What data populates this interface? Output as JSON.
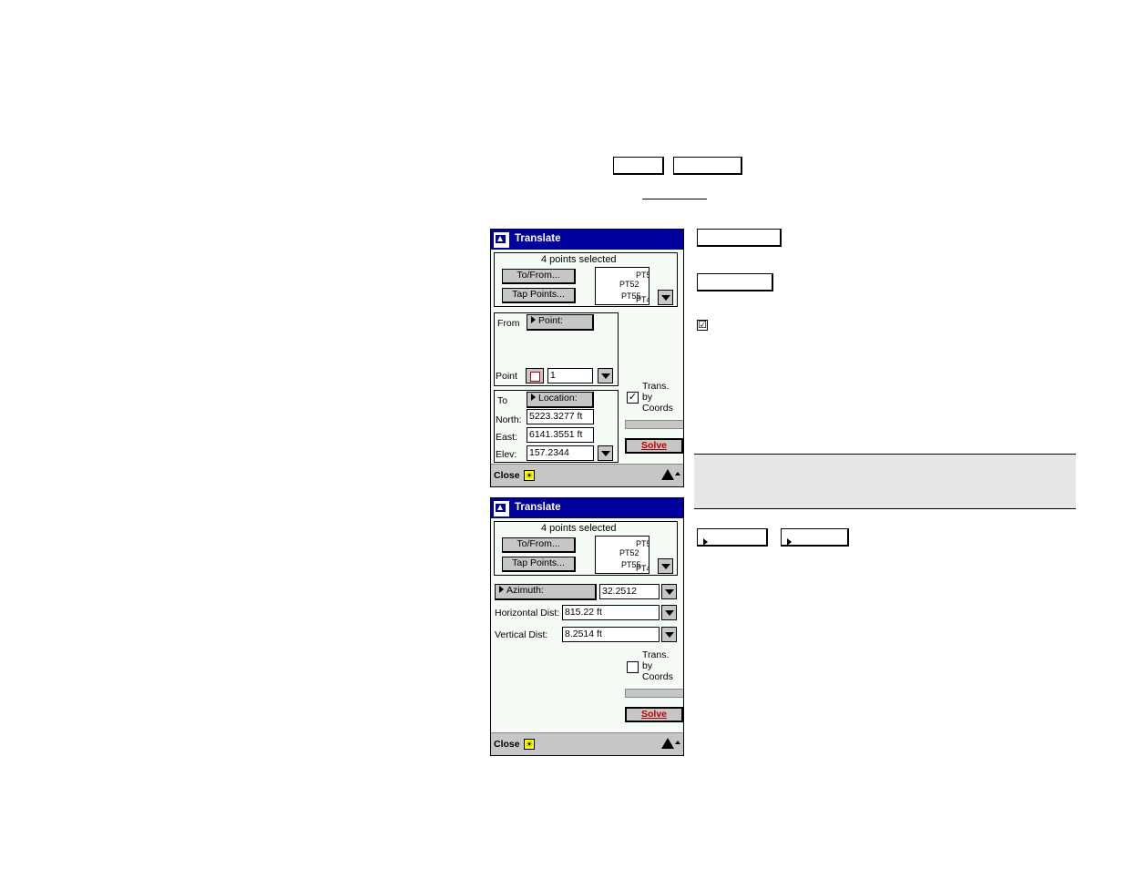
{
  "title": "Translate",
  "points_selected": "4 points selected",
  "to_from_label": "To/From...",
  "tap_points_label": "Tap Points...",
  "preview_labels": [
    "PT5",
    "PT52",
    "PT55",
    "PT4"
  ],
  "from_label": "From",
  "from_mode": "Point:",
  "point_label": "Point",
  "point_value": "1",
  "to_label": "To",
  "to_mode": "Location:",
  "north_label": "North:",
  "north_value": "5223.3277 ft",
  "east_label": "East:",
  "east_value": "6141.3551 ft",
  "elev_label": "Elev:",
  "elev_value": "157.2344",
  "trans_label_1": "Trans.",
  "trans_label_2": "by",
  "trans_label_3": "Coords",
  "trans_checked_mark": "✓",
  "solve_label": "Solve",
  "close_label": "Close",
  "sun_glyph": "☀",
  "azimuth_label": "Azimuth:",
  "azimuth_value": "32.2512",
  "hdist_label": "Horizontal Dist:",
  "hdist_value": "815.22 ft",
  "vdist_label": "Vertical Dist:",
  "vdist_value": "8.2514 ft",
  "doc_checkbox_mark": "☑",
  "icons": {
    "app": "app-icon",
    "dropdown": "chevron-down-icon",
    "point_pick": "map-pick-icon",
    "warning": "warning-icon",
    "scroll_up": "arrow-up-icon",
    "sun": "sun-icon",
    "mode": "triangle-right-icon"
  },
  "colors": {
    "titlebar": "#00009c",
    "screen_bg": "#f4faf4",
    "button": "#c6c6c6",
    "solve_text": "#c00000",
    "note_bg": "#e6e6e6"
  }
}
